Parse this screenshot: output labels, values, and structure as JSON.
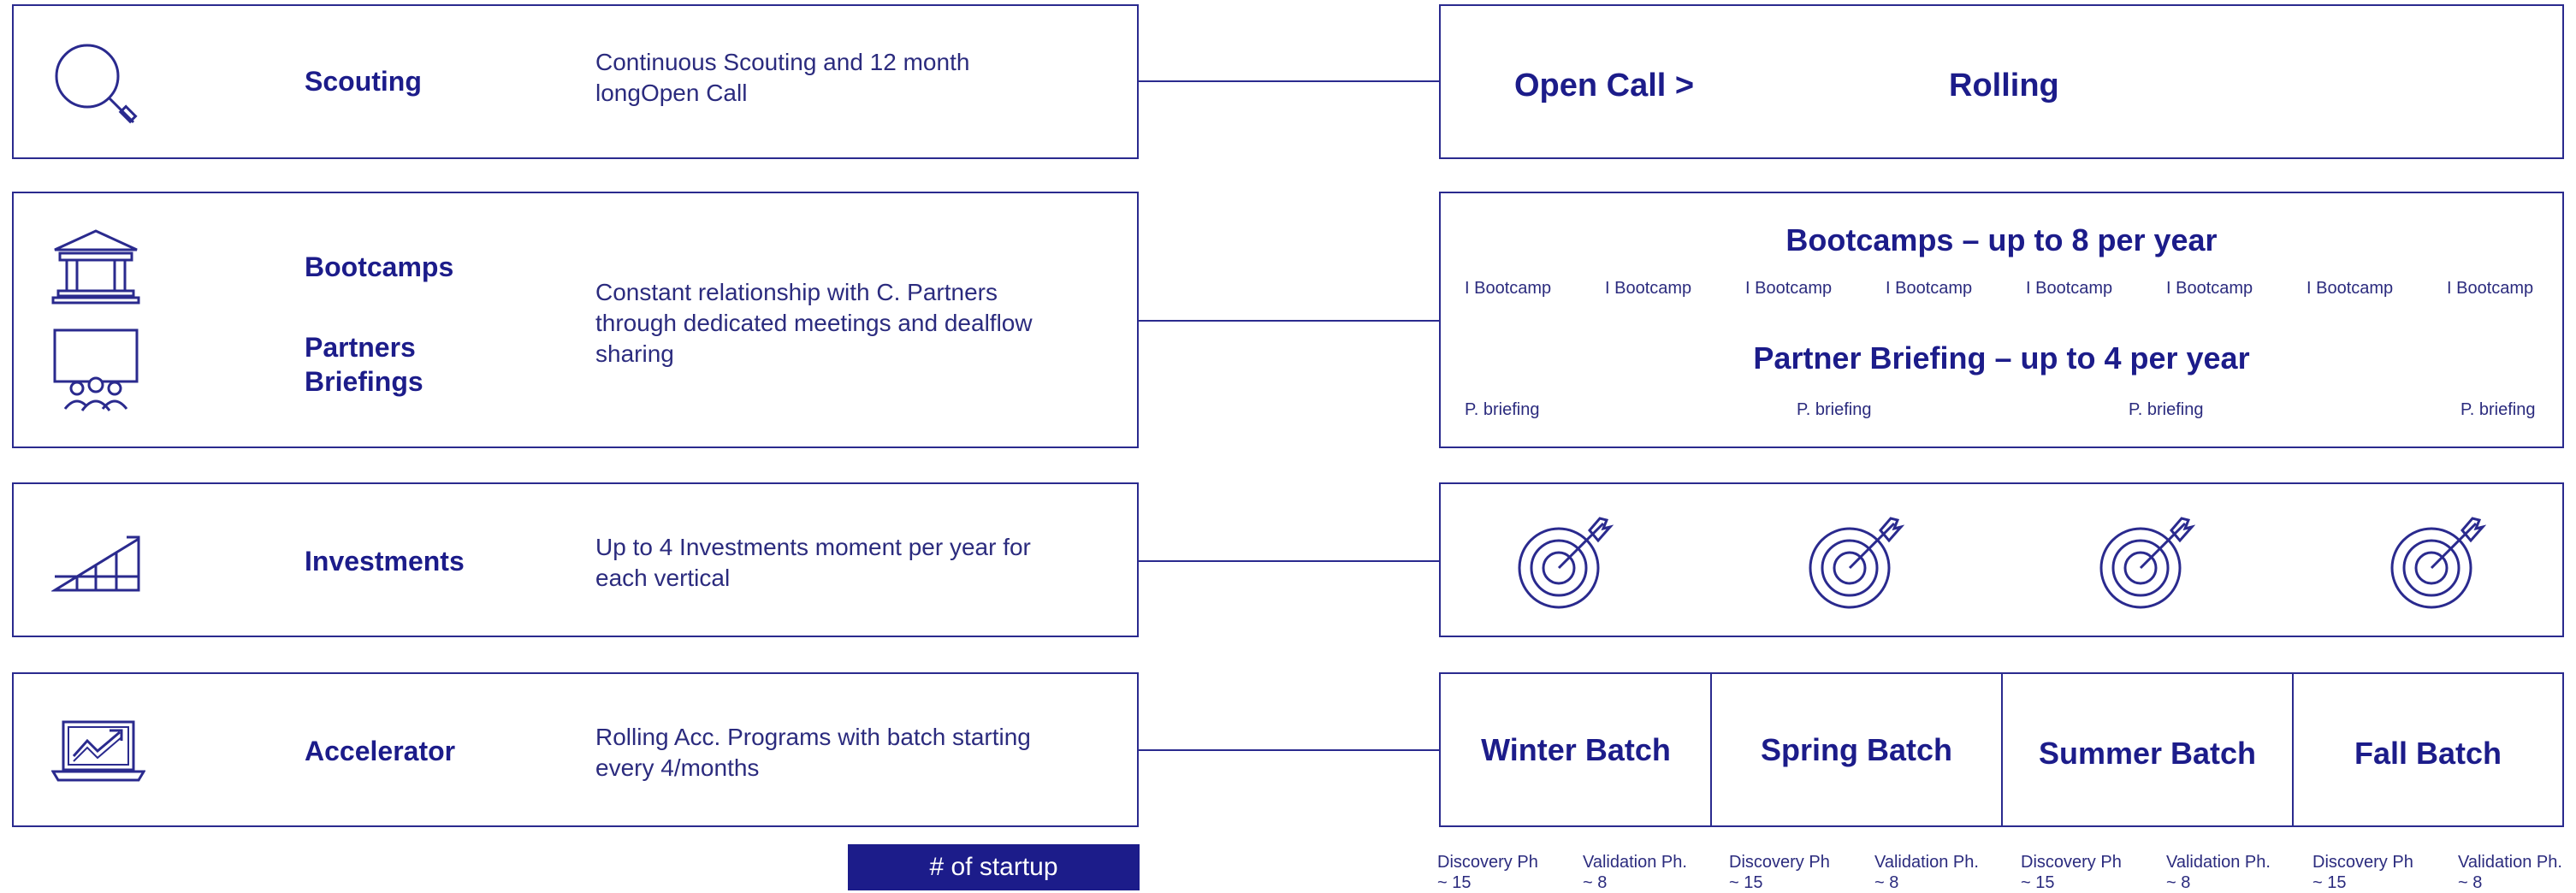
{
  "rows": [
    {
      "title": "Scouting",
      "desc": "Continuous Scouting and 12 month\n longOpen Call",
      "icon": "magnifier-icon"
    },
    {
      "title_a": "Bootcamps",
      "title_b": "Partners\nBriefings",
      "desc": "Constant relationship with C. Partners\nthrough dedicated meetings and dealflow\nsharing",
      "icon_a": "building-icon",
      "icon_b": "presentation-audience-icon"
    },
    {
      "title": "Investments",
      "desc": "Up to 4 Investments moment per year for\neach vertical",
      "icon": "growth-chart-icon"
    },
    {
      "title": "Accelerator",
      "desc": "Rolling Acc. Programs with batch starting\nevery 4/months",
      "icon": "laptop-chart-icon"
    }
  ],
  "open_call": {
    "label": "Open Call >",
    "value": "Rolling"
  },
  "bootcamps": {
    "heading": "Bootcamps – up to 8 per year",
    "items": [
      "I Bootcamp",
      "I Bootcamp",
      "I Bootcamp",
      "I Bootcamp",
      "I Bootcamp",
      "I Bootcamp",
      "I Bootcamp",
      "I Bootcamp"
    ]
  },
  "briefings": {
    "heading": "Partner Briefing – up to 4 per year",
    "items": [
      "P. briefing",
      "P. briefing",
      "P. briefing",
      "P. briefing"
    ]
  },
  "investments": {
    "icon": "target-arrow-icon",
    "count": 4
  },
  "batches": [
    "Winter Batch",
    "Spring Batch",
    "Summer Batch",
    "Fall Batch"
  ],
  "phases": [
    {
      "discovery": "Discovery Ph\n~ 15",
      "validation": "Validation Ph.\n~ 8"
    },
    {
      "discovery": "Discovery Ph\n~ 15",
      "validation": "Validation Ph.\n~ 8"
    },
    {
      "discovery": "Discovery Ph\n~ 15",
      "validation": "Validation Ph.\n~ 8"
    },
    {
      "discovery": "Discovery Ph\n~ 15",
      "validation": "Validation Ph.\n~ 8"
    }
  ],
  "legend": "# of startup",
  "colors": {
    "primary": "#1c1c8a",
    "border": "#2a2a8e"
  }
}
